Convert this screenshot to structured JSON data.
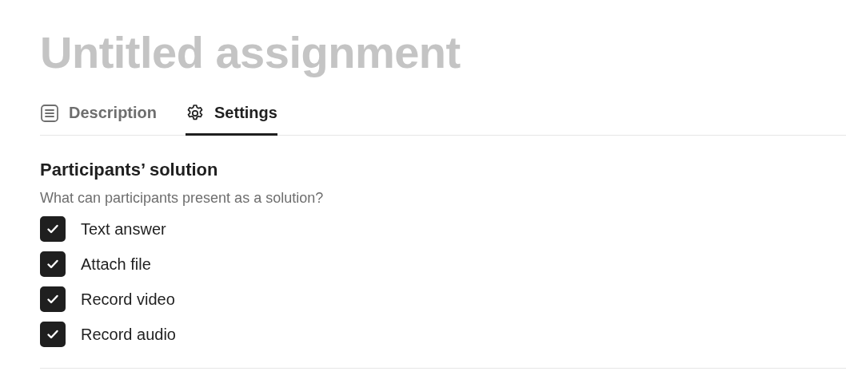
{
  "title": "Untitled assignment",
  "tabs": [
    {
      "label": "Description",
      "selected": false
    },
    {
      "label": "Settings",
      "selected": true
    }
  ],
  "section": {
    "heading": "Participants’ solution",
    "description": "What can participants present as a solution?",
    "options": [
      {
        "label": "Text answer",
        "checked": true
      },
      {
        "label": "Attach file",
        "checked": true
      },
      {
        "label": "Record video",
        "checked": true
      },
      {
        "label": "Record audio",
        "checked": true
      }
    ]
  }
}
